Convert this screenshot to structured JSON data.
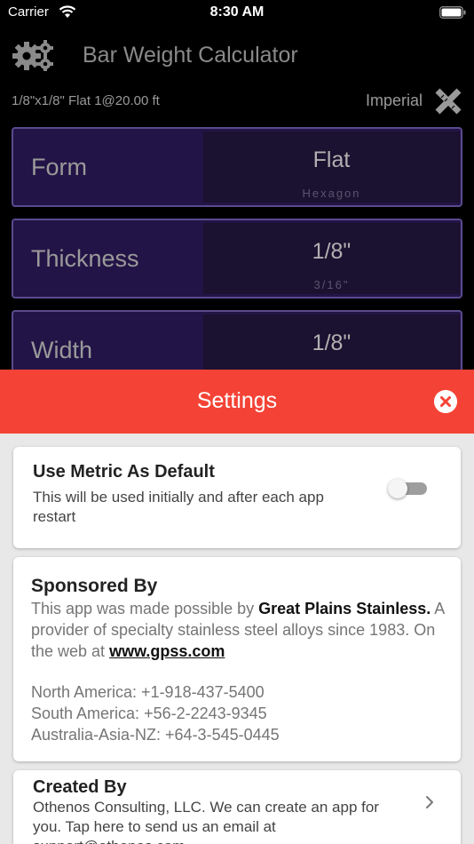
{
  "status_bar": {
    "carrier": "Carrier",
    "time": "8:30 AM"
  },
  "header": {
    "title": "Bar Weight Calculator",
    "summary": "1/8\"x1/8\" Flat 1@20.00 ft",
    "units": "Imperial"
  },
  "pickers": [
    {
      "label": "Form",
      "value": "Flat",
      "next": "Hexagon"
    },
    {
      "label": "Thickness",
      "value": "1/8\"",
      "next": "3/16\""
    },
    {
      "label": "Width",
      "value": "1/8\"",
      "next": ""
    }
  ],
  "settings": {
    "title": "Settings",
    "metric": {
      "title": "Use Metric As Default",
      "description": "This will be used initially and after each app restart",
      "enabled": false
    },
    "sponsor": {
      "title": "Sponsored By",
      "intro": "This app was made possible by ",
      "company": "Great Plains Stainless.",
      "body": " A provider of specialty stainless steel alloys since 1983. On the web at ",
      "website": "www.gpss.com",
      "contacts": [
        "North America: +1-918-437-5400",
        "South America: +56-2-2243-9345",
        "Australia-Asia-NZ: +64-3-545-0445"
      ]
    },
    "creator": {
      "title": "Created By",
      "text": "Othenos Consulting, LLC. We can create an app for you. Tap here to send us an email at support@othenos.com"
    }
  },
  "colors": {
    "accent_red": "#f44336",
    "picker_bg": "#231447",
    "picker_border": "#5a4a8e",
    "settings_bg": "#e8e8e8"
  },
  "icons": [
    "wifi-icon",
    "battery-icon",
    "gear-icon",
    "ruler-pencil-icon",
    "close-icon",
    "chevron-right-icon"
  ]
}
